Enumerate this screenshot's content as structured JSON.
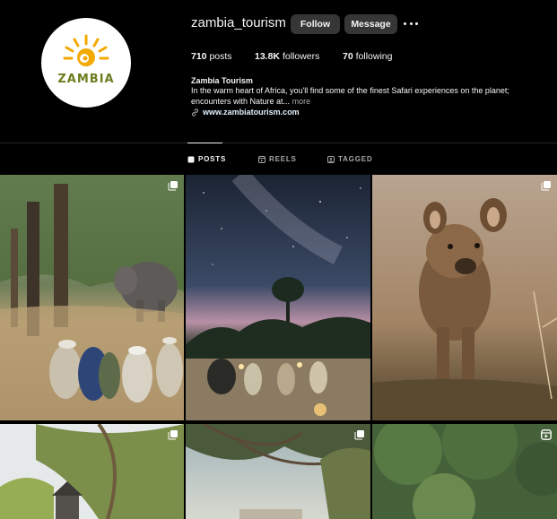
{
  "profile": {
    "username": "zambia_tourism",
    "avatar_text": "ZAMBIA",
    "follow_label": "Follow",
    "message_label": "Message",
    "stats": {
      "posts_count": "710",
      "posts_label": "posts",
      "followers_count": "13.8K",
      "followers_label": "followers",
      "following_count": "70",
      "following_label": "following"
    },
    "bio": {
      "name": "Zambia Tourism",
      "text": "In the warm heart of Africa, you'll find some of the finest Safari experiences on the planet; encounters with Nature at...",
      "more_label": "more",
      "link": "www.zambiatourism.com"
    }
  },
  "tabs": [
    {
      "label": "POSTS",
      "active": true,
      "icon": "grid-icon"
    },
    {
      "label": "REELS",
      "active": false,
      "icon": "reels-icon"
    },
    {
      "label": "TAGGED",
      "active": false,
      "icon": "tagged-icon"
    }
  ],
  "posts": [
    {
      "subject": "safari walk with elephant",
      "badge": "carousel-icon"
    },
    {
      "subject": "bush camp under milky way",
      "badge": ""
    },
    {
      "subject": "hyena cub",
      "badge": "carousel-icon"
    },
    {
      "subject": "treehouse lodge",
      "badge": "carousel-icon"
    },
    {
      "subject": "riverside deck under tree",
      "badge": "carousel-icon"
    },
    {
      "subject": "green foliage",
      "badge": "reel-icon"
    }
  ],
  "colors": {
    "background": "#000000",
    "button": "#363636",
    "secondary_text": "#a8a8a8",
    "link_text": "#e0f1ff",
    "logo_sun": "#f2a900",
    "logo_text": "#6b7f1f"
  }
}
